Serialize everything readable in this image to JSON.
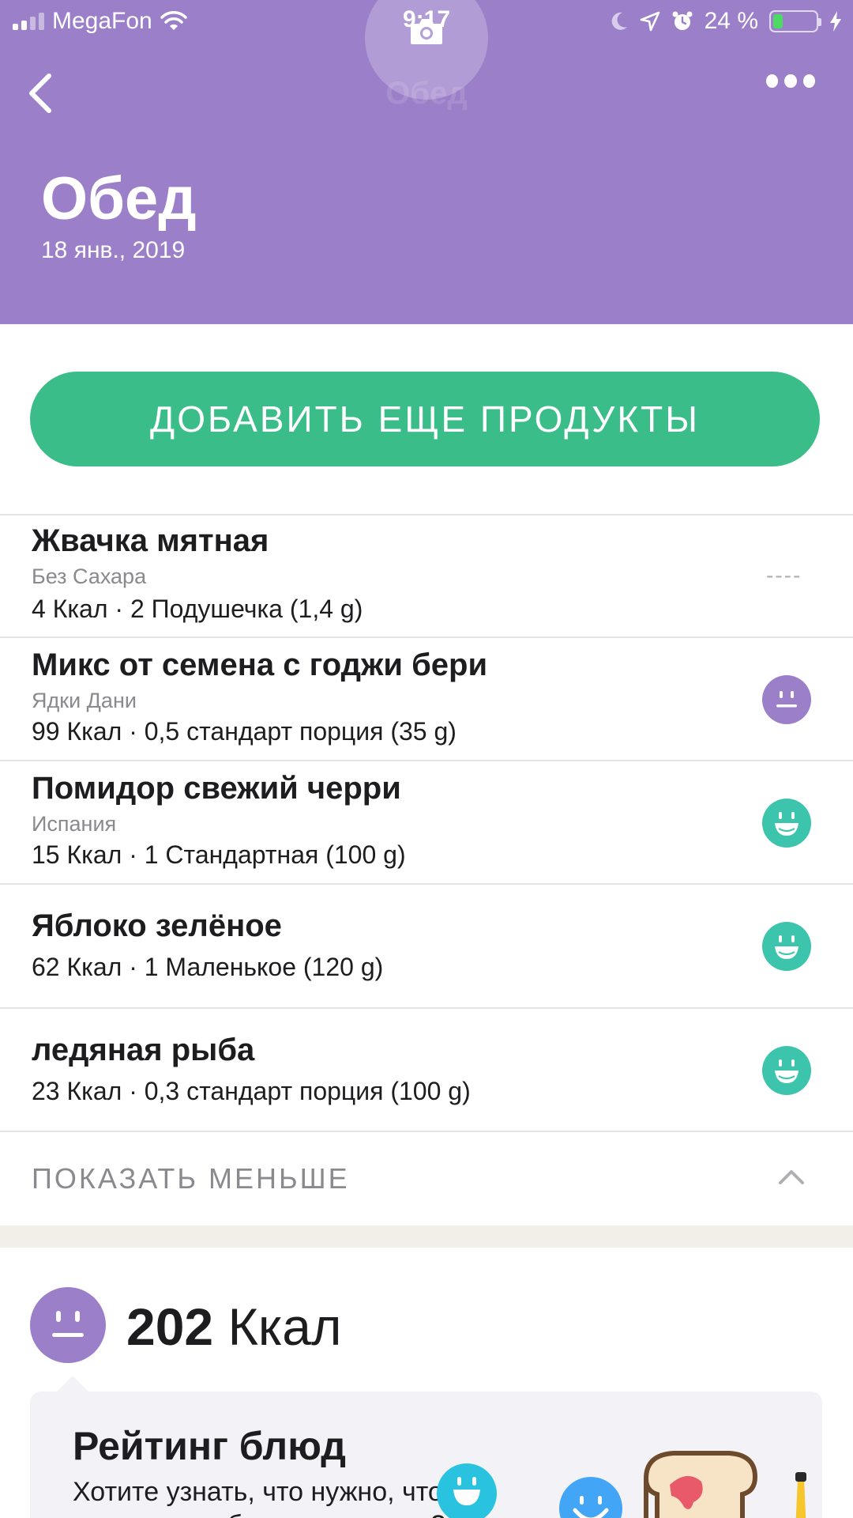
{
  "status_bar": {
    "carrier": "MegaFon",
    "time": "9:17",
    "battery_percent": "24 %",
    "battery_level": 0.24
  },
  "header": {
    "ghost_title": "Обед",
    "title": "Обед",
    "date": "18 янв., 2019"
  },
  "add_button": {
    "label": "ДОБАВИТЬ ЕЩЕ ПРОДУКТЫ"
  },
  "food_items": [
    {
      "name": "Жвачка мятная",
      "brand": "Без Сахара",
      "kcal_line": "4 Ккал · 2 Подушечка (1,4 g)",
      "rating": "none",
      "rating_text": "----"
    },
    {
      "name": "Микс от семена с годжи бери",
      "brand": "Ядки Дани",
      "kcal_line": "99 Ккал · 0,5 стандарт порция (35 g)",
      "rating": "neutral"
    },
    {
      "name": "Помидор свежий черри",
      "brand": "Испания",
      "kcal_line": "15 Ккал · 1 Стандартная (100 g)",
      "rating": "happy"
    },
    {
      "name": "Яблоко зелёное",
      "kcal_line": "62 Ккал · 1 Маленькое (120 g)",
      "rating": "happy"
    },
    {
      "name": "ледяная рыба",
      "kcal_line": "23 Ккал · 0,3 стандарт порция (100 g)",
      "rating": "happy"
    }
  ],
  "show_less": {
    "label": "ПОКАЗАТЬ МЕНЬШЕ"
  },
  "summary": {
    "kcal_value": "202",
    "kcal_unit": "Ккал",
    "rating": "neutral"
  },
  "rating_card": {
    "title": "Рейтинг блюд",
    "text": "Хотите узнать, что нужно, чтобы сделать это блюдо здоровее?"
  },
  "colors": {
    "header": "#9b80c9",
    "add_button": "#3bbd8a",
    "happy_rating": "#3cc4ad",
    "neutral_rating": "#9b80c9",
    "section_band": "#f2efe9"
  },
  "icons": {
    "back": "chevron-left-icon",
    "more": "more-dots-icon",
    "camera": "camera-icon",
    "collapse": "chevron-up-icon",
    "wifi": "wifi-icon",
    "moon": "moon-icon",
    "location": "location-arrow-icon",
    "alarm": "alarm-icon",
    "charging": "bolt-icon"
  }
}
